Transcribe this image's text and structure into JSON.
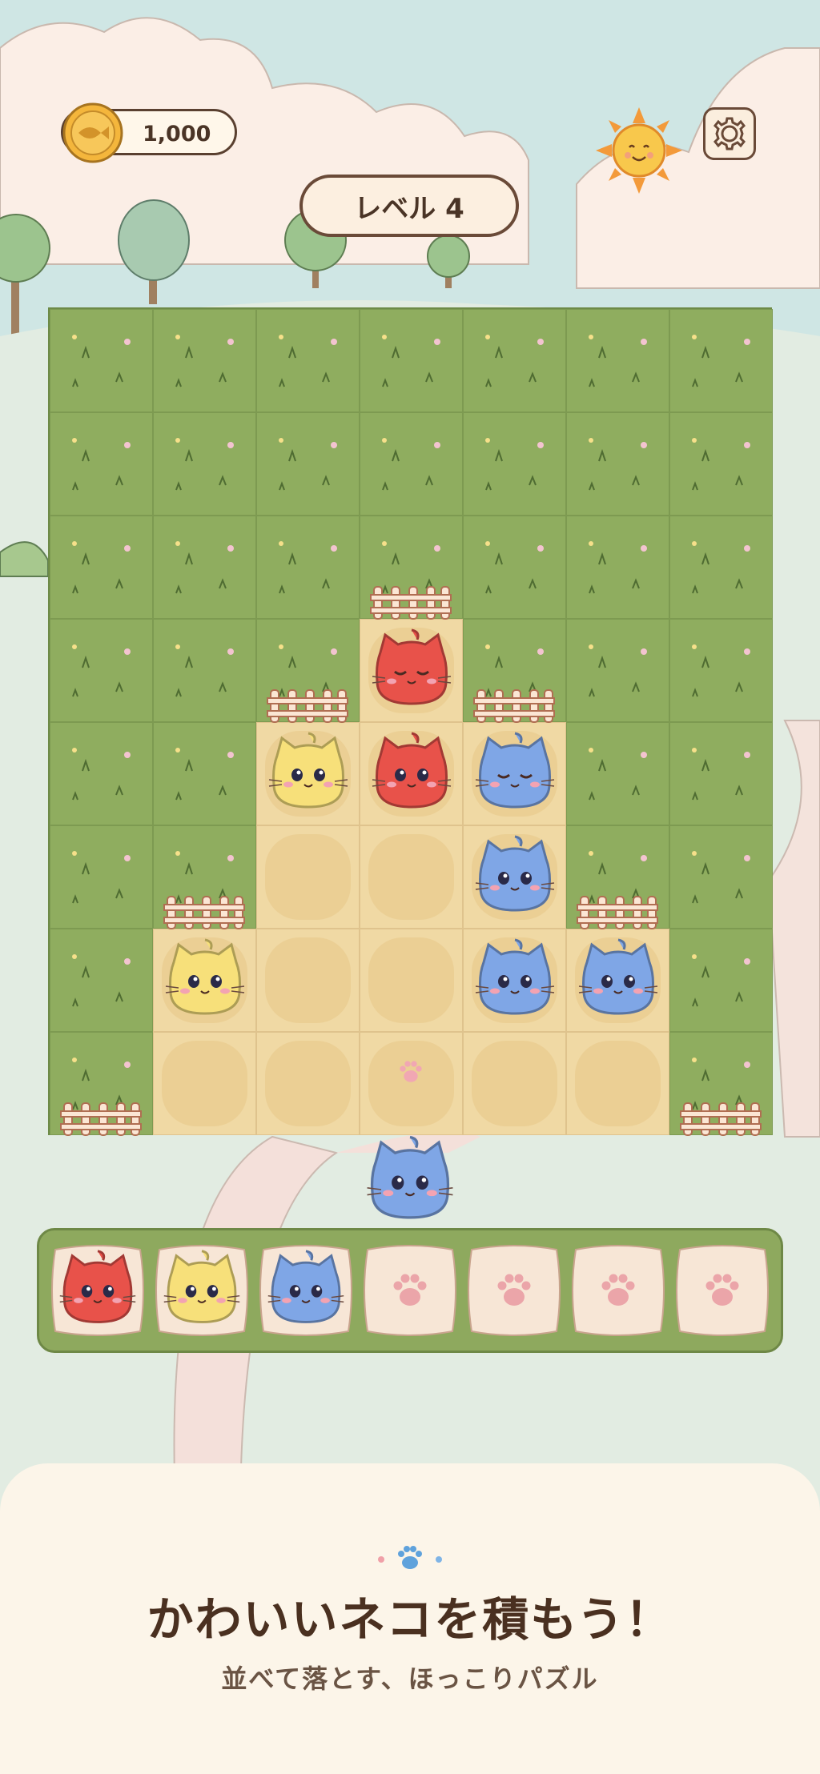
{
  "hud": {
    "coin_value": "1,000",
    "level_label": "レベル 4"
  },
  "board": {
    "columns": 7,
    "rows": 8,
    "sand_cells": [
      [
        3,
        3
      ],
      [
        2,
        4
      ],
      [
        3,
        4
      ],
      [
        4,
        4
      ],
      [
        2,
        5
      ],
      [
        3,
        5
      ],
      [
        4,
        5
      ],
      [
        1,
        6
      ],
      [
        2,
        6
      ],
      [
        3,
        6
      ],
      [
        4,
        6
      ],
      [
        5,
        6
      ],
      [
        1,
        7
      ],
      [
        2,
        7
      ],
      [
        3,
        7
      ],
      [
        4,
        7
      ],
      [
        5,
        7
      ]
    ],
    "cats": [
      {
        "col": 3,
        "row": 3,
        "color": "red",
        "eyes": "closed"
      },
      {
        "col": 2,
        "row": 4,
        "color": "yellow",
        "eyes": "open"
      },
      {
        "col": 3,
        "row": 4,
        "color": "red",
        "eyes": "open"
      },
      {
        "col": 4,
        "row": 4,
        "color": "blue",
        "eyes": "closed"
      },
      {
        "col": 4,
        "row": 5,
        "color": "blue",
        "eyes": "open"
      },
      {
        "col": 1,
        "row": 6,
        "color": "yellow",
        "eyes": "open"
      },
      {
        "col": 4,
        "row": 6,
        "color": "blue",
        "eyes": "open"
      },
      {
        "col": 5,
        "row": 6,
        "color": "blue",
        "eyes": "open"
      }
    ],
    "paw_print_cell": [
      3,
      7
    ]
  },
  "falling_cat": {
    "color": "blue",
    "eyes": "open"
  },
  "tray": {
    "slots": [
      "red",
      "yellow",
      "blue",
      "empty",
      "empty",
      "empty",
      "empty"
    ]
  },
  "colors": {
    "red": "#e8524a",
    "yellow": "#f7e07a",
    "blue": "#7fa6e6",
    "grass": "#8fad5f",
    "sand": "#f0d9a4",
    "pillow": "#f7e6d6"
  },
  "footer": {
    "tagline": "かわいいネコを積もう！",
    "subtitle": "並べて落とす、ほっこりパズル"
  }
}
